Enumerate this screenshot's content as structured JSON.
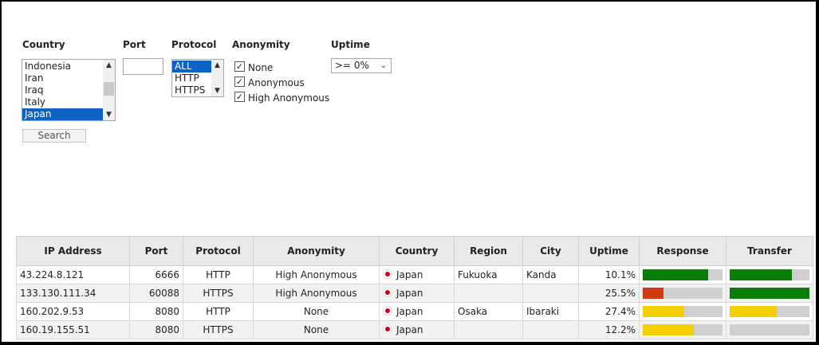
{
  "filters": {
    "country_label": "Country",
    "country_options": [
      "Indonesia",
      "Iran",
      "Iraq",
      "Italy",
      "Japan"
    ],
    "country_selected": "Japan",
    "port_label": "Port",
    "port_value": "",
    "protocol_label": "Protocol",
    "protocol_options": [
      "ALL",
      "HTTP",
      "HTTPS"
    ],
    "protocol_selected": "ALL",
    "anonymity_label": "Anonymity",
    "anonymity_options": [
      {
        "label": "None",
        "checked": true
      },
      {
        "label": "Anonymous",
        "checked": true
      },
      {
        "label": "High Anonymous",
        "checked": true
      }
    ],
    "uptime_label": "Uptime",
    "uptime_value": ">= 0%",
    "search_label": "Search"
  },
  "table": {
    "headers": [
      "IP Address",
      "Port",
      "Protocol",
      "Anonymity",
      "Country",
      "Region",
      "City",
      "Uptime",
      "Response",
      "Transfer"
    ],
    "rows": [
      {
        "ip": "43.224.8.121",
        "port": "6666",
        "protocol": "HTTP",
        "anonymity": "High Anonymous",
        "country": "Japan",
        "region": "Fukuoka",
        "city": "Kanda",
        "uptime": "10.1%",
        "response": 0.82,
        "response_color": "#0a7d0a",
        "transfer": 0.78,
        "transfer_color": "#0a7d0a"
      },
      {
        "ip": "133.130.111.34",
        "port": "60088",
        "protocol": "HTTPS",
        "anonymity": "High Anonymous",
        "country": "Japan",
        "region": "",
        "city": "",
        "uptime": "25.5%",
        "response": 0.26,
        "response_color": "#d03a10",
        "transfer": 1.0,
        "transfer_color": "#0a7d0a"
      },
      {
        "ip": "160.202.9.53",
        "port": "8080",
        "protocol": "HTTP",
        "anonymity": "None",
        "country": "Japan",
        "region": "Osaka",
        "city": "Ibaraki",
        "uptime": "27.4%",
        "response": 0.52,
        "response_color": "#f5d000",
        "transfer": 0.59,
        "transfer_color": "#f5d000"
      },
      {
        "ip": "160.19.155.51",
        "port": "8080",
        "protocol": "HTTPS",
        "anonymity": "None",
        "country": "Japan",
        "region": "",
        "city": "",
        "uptime": "12.2%",
        "response": 0.64,
        "response_color": "#f5d000",
        "transfer": 0.0,
        "transfer_color": "#cfcfcf"
      }
    ]
  }
}
